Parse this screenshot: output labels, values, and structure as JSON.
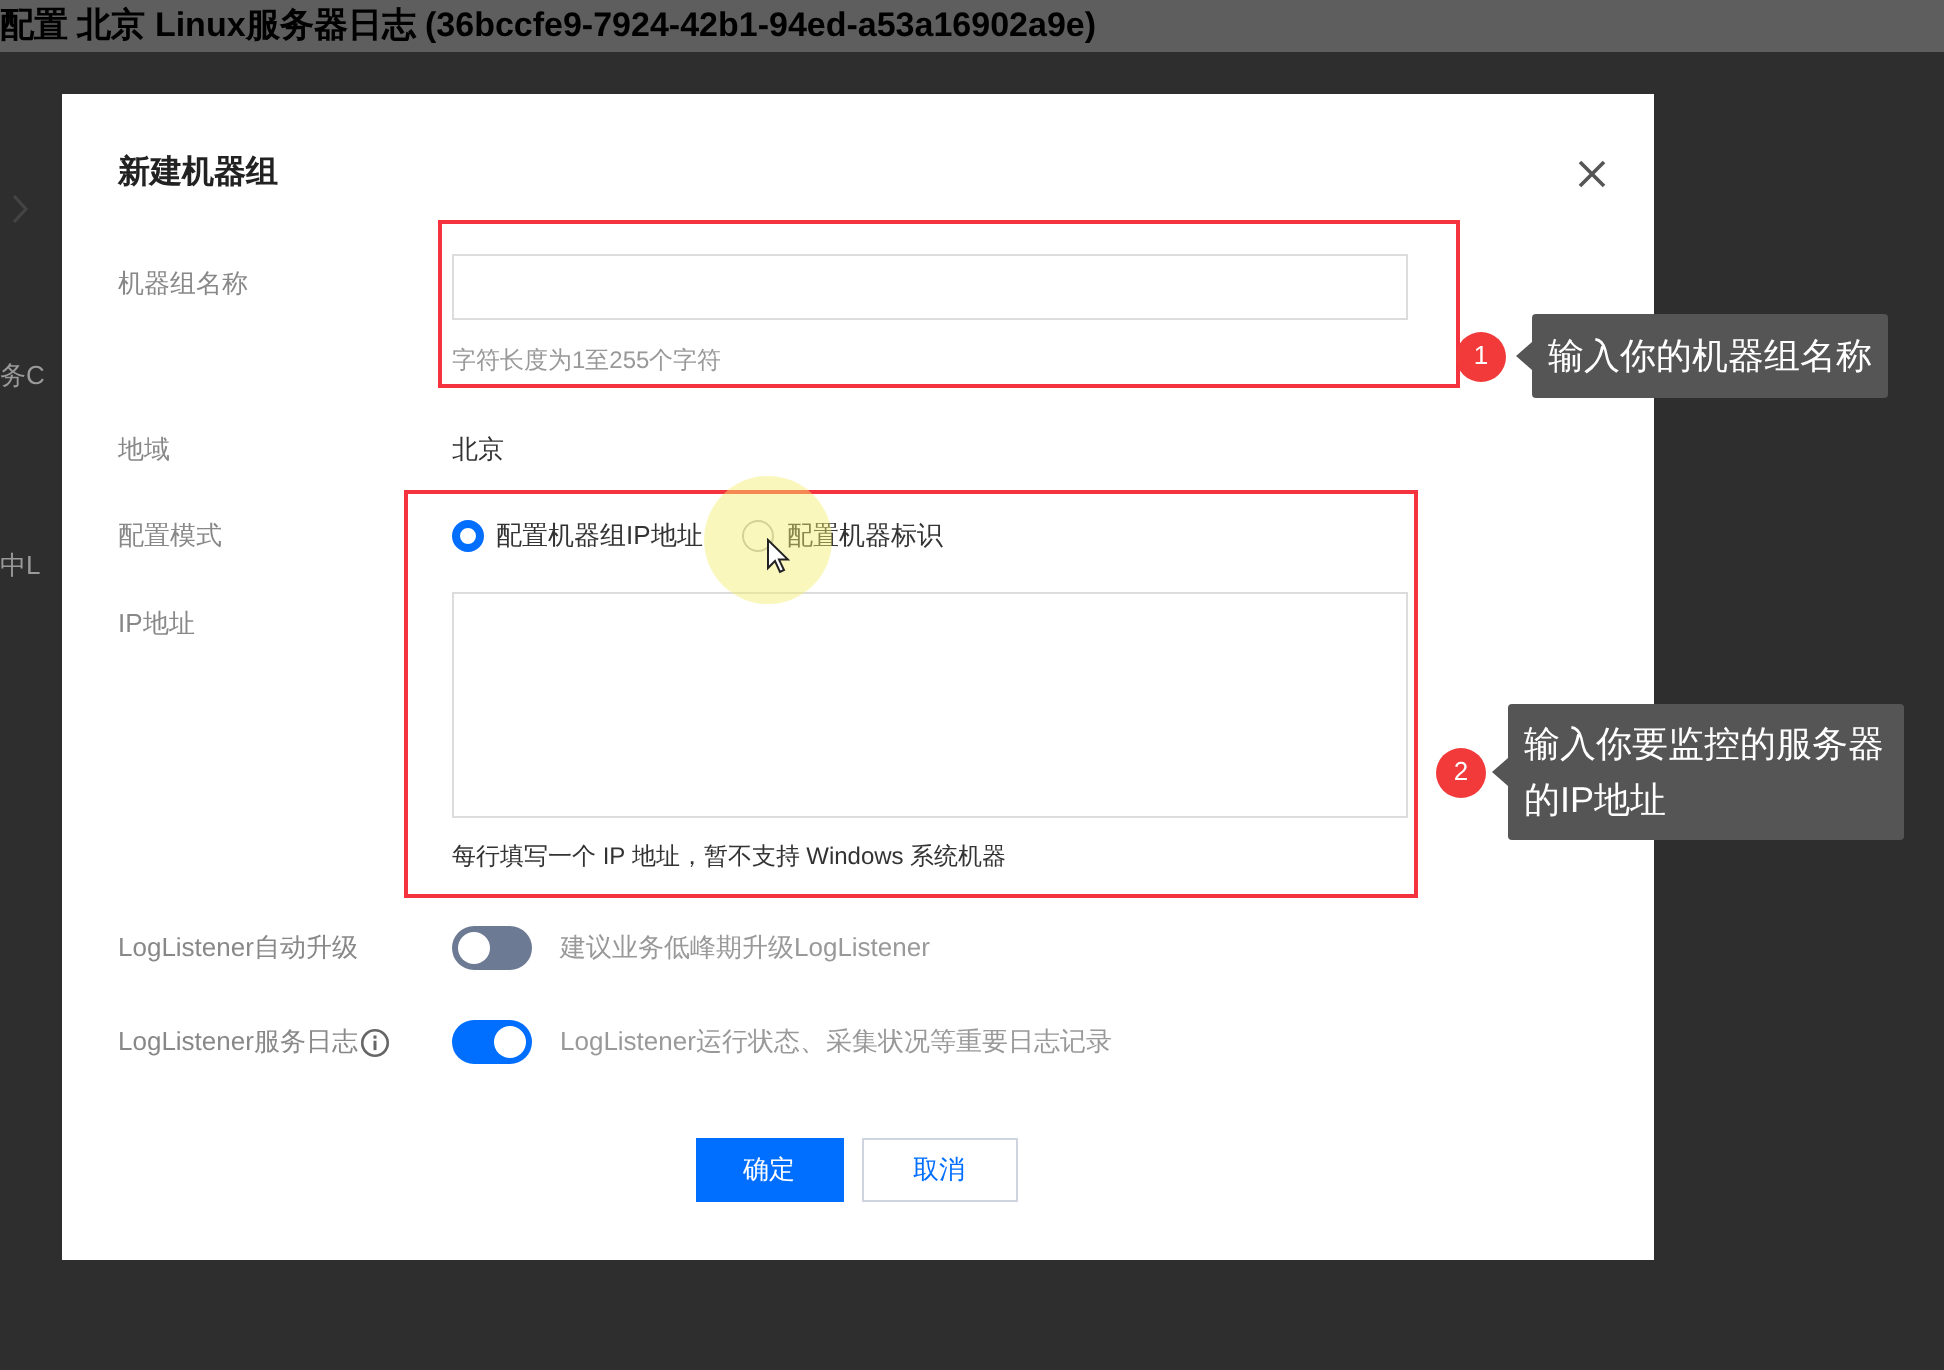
{
  "page": {
    "title": "配置 北京 Linux服务器日志 (36bccfe9-7924-42b1-94ed-a53a16902a9e)",
    "background_fragments": [
      "务C",
      "中L"
    ]
  },
  "dialog": {
    "title": "新建机器组",
    "fields": [
      {
        "kind": "text_input",
        "label": "机器组名称",
        "hint": "字符长度为1至255个字符"
      },
      {
        "kind": "static",
        "label": "地域",
        "value": "北京"
      },
      {
        "kind": "radio_group",
        "label": "配置模式",
        "options": [
          {
            "label": "配置机器组IP地址",
            "selected": true
          },
          {
            "label": "配置机器标识",
            "selected": false
          }
        ]
      },
      {
        "kind": "textarea",
        "label": "IP地址",
        "hint": "每行填写一个 IP 地址，暂不支持 Windows 系统机器"
      },
      {
        "kind": "switch",
        "label": "LogListener自动升级",
        "on": false,
        "description": "建议业务低峰期升级LogListener"
      },
      {
        "kind": "switch",
        "label": "LogListener服务日志",
        "info": true,
        "on": true,
        "description": "LogListener运行状态、采集状况等重要日志记录"
      }
    ],
    "buttons": [
      {
        "label": "确定",
        "kind": "primary"
      },
      {
        "label": "取消",
        "kind": "secondary"
      }
    ]
  },
  "annotations": [
    {
      "number": "1",
      "text": "输入你的机器组名称"
    },
    {
      "number": "2",
      "text": "输入你要监控的服务器的IP地址"
    }
  ]
}
